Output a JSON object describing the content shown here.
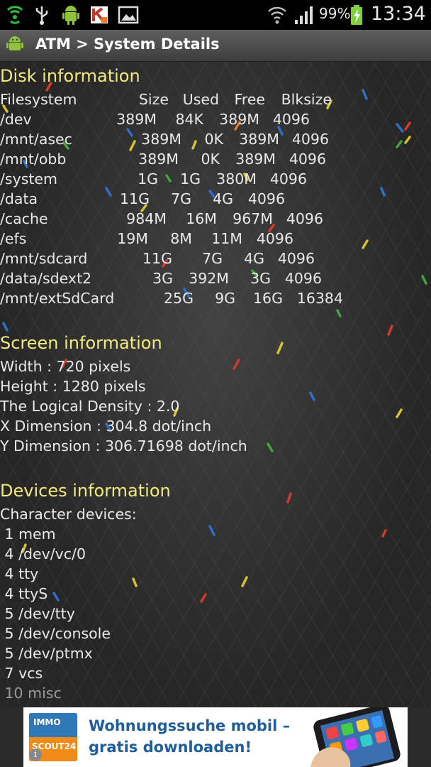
{
  "status_bar": {
    "battery_percent": "99%",
    "time": "13:34",
    "icons": [
      "wifi-hotspot-icon",
      "usb-icon",
      "android-icon",
      "kaspersky-icon",
      "gallery-icon",
      "wifi-icon",
      "signal-icon",
      "battery-charging-icon"
    ]
  },
  "action_bar": {
    "title": "ATM > System Details",
    "icon": "android-app-icon"
  },
  "disk": {
    "title": "Disk information",
    "header": {
      "filesystem": "Filesystem",
      "size": "Size",
      "used": "Used",
      "free": "Free",
      "blksize": "Blksize"
    },
    "rows": [
      {
        "name": "/dev",
        "size": "389M",
        "used": "84K",
        "free": "389M",
        "blksize": "4096"
      },
      {
        "name": "/mnt/asec",
        "size": "389M",
        "used": "0K",
        "free": "389M",
        "blksize": "4096"
      },
      {
        "name": "/mnt/obb",
        "size": "389M",
        "used": "0K",
        "free": "389M",
        "blksize": "4096"
      },
      {
        "name": "/system",
        "size": "1G",
        "used": "1G",
        "free": "380M",
        "blksize": "4096"
      },
      {
        "name": "/data",
        "size": "11G",
        "used": "7G",
        "free": "4G",
        "blksize": "4096"
      },
      {
        "name": "/cache",
        "size": "984M",
        "used": "16M",
        "free": "967M",
        "blksize": "4096"
      },
      {
        "name": "/efs",
        "size": "19M",
        "used": "8M",
        "free": "11M",
        "blksize": "4096"
      },
      {
        "name": "/mnt/sdcard",
        "size": "11G",
        "used": "7G",
        "free": "4G",
        "blksize": "4096"
      },
      {
        "name": "/data/sdext2",
        "size": "3G",
        "used": "392M",
        "free": "3G",
        "blksize": "4096"
      },
      {
        "name": "/mnt/extSdCard",
        "size": "25G",
        "used": "9G",
        "free": "16G",
        "blksize": "16384"
      }
    ]
  },
  "screen": {
    "title": "Screen information",
    "lines": [
      "Width : 720 pixels",
      "Height : 1280 pixels",
      "The Logical Density : 2.0",
      "X Dimension : 304.8 dot/inch",
      "Y Dimension : 306.71698 dot/inch"
    ]
  },
  "devices": {
    "title": "Devices information",
    "subtitle": "Character devices:",
    "lines": [
      " 1 mem",
      " 4 /dev/vc/0",
      " 4 tty",
      " 4 ttyS",
      " 5 /dev/tty",
      " 5 /dev/console",
      " 5 /dev/ptmx",
      " 7 vcs",
      " 10 misc"
    ]
  },
  "ad": {
    "logo_top": "IMMO",
    "logo_bottom": "SCOUT24",
    "line1": "Wohnungssuche mobil –",
    "line2": "gratis downloaden!",
    "info_glyph": "i"
  },
  "colors": {
    "section_title": "#f0ea7c",
    "text": "#e9e9e9",
    "background": "#262626",
    "ad_text": "#1f5e9e"
  }
}
